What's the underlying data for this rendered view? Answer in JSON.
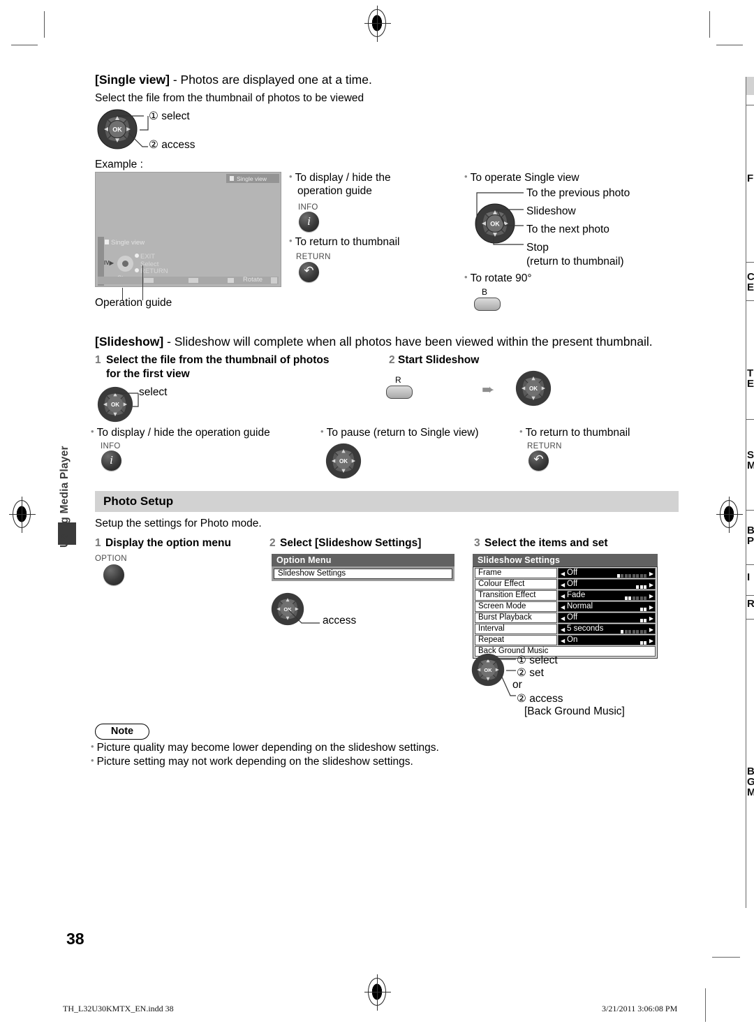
{
  "sidebar": {
    "tab_label": "Using Media Player"
  },
  "single_view": {
    "heading_bracket": "[Single view]",
    "heading_rest": " - Photos are displayed one at a time.",
    "instruction": "Select the file from the thumbnail of photos to be viewed",
    "step_select": "① select",
    "step_access": "② access",
    "example_label": "Example :",
    "operation_guide_label": "Operation guide",
    "tv": {
      "top_badge": "Single view",
      "mode_label": "Single view",
      "side_label": "IV",
      "guide_exit": "EXIT",
      "guide_select": "Select",
      "guide_return": "RETURN",
      "stop_label": "Stop",
      "rotate_label": "Rotate"
    },
    "callouts": {
      "display_hide": "To display / hide the",
      "display_hide_2": "operation guide",
      "info_cap": "INFO",
      "return_thumb": "To return to thumbnail",
      "return_cap": "RETURN",
      "operate": "To operate Single view",
      "previous_photo": "To the previous photo",
      "slideshow": "Slideshow",
      "next_photo": "To the next photo",
      "stop": "Stop",
      "stop_sub": "(return to thumbnail)",
      "rotate": "To rotate 90°",
      "rotate_btn_cap": "B"
    }
  },
  "slideshow": {
    "heading_bracket": "[Slideshow]",
    "heading_rest": " - Slideshow will complete when all photos have been viewed within the present thumbnail.",
    "step1_num": "1",
    "step1_line1": "Select the file from the thumbnail of photos",
    "step1_line2": "for the first view",
    "step1_select": "select",
    "step2_num": "2",
    "step2_label": "Start Slideshow",
    "step2_btn_cap": "R",
    "callout_display": "To display / hide the operation guide",
    "callout_display_cap": "INFO",
    "callout_pause": "To pause (return to Single view)",
    "callout_return": "To return to thumbnail",
    "callout_return_cap": "RETURN"
  },
  "photo_setup": {
    "section_title": "Photo Setup",
    "intro": "Setup the settings for Photo mode.",
    "step1_num": "1",
    "step1_label": "Display the option menu",
    "step1_btn_cap": "OPTION",
    "step2_num": "2",
    "step2_label": "Select [Slideshow Settings]",
    "step2_access": "access",
    "step3_num": "3",
    "step3_label": "Select the items and set",
    "option_menu": {
      "title": "Option Menu",
      "items": [
        "Slideshow Settings"
      ]
    },
    "slideshow_settings": {
      "title": "Slideshow Settings",
      "rows": [
        {
          "name": "Frame",
          "value": "Off",
          "gauge_on": 1,
          "gauge_total": 8
        },
        {
          "name": "Colour Effect",
          "value": "Off",
          "gauge_on": 3,
          "gauge_total": 3
        },
        {
          "name": "Transition Effect",
          "value": "Fade",
          "gauge_on": 2,
          "gauge_total": 6
        },
        {
          "name": "Screen Mode",
          "value": "Normal",
          "gauge_on": 2,
          "gauge_total": 2
        },
        {
          "name": "Burst Playback",
          "value": "Off",
          "gauge_on": 2,
          "gauge_total": 2
        },
        {
          "name": "Interval",
          "value": "5 seconds",
          "gauge_on": 1,
          "gauge_total": 7
        },
        {
          "name": "Repeat",
          "value": "On",
          "gauge_on": 2,
          "gauge_total": 2
        }
      ],
      "full_row": "Back Ground Music"
    },
    "select_label": "① select",
    "set_label": "② set",
    "or_label": "or",
    "access_label": "② access",
    "bgm_label": "[Back Ground Music]"
  },
  "note": {
    "badge": "Note",
    "items": [
      "Picture quality may become lower depending on the slideshow settings.",
      "Picture setting may not work depending on the slideshow settings."
    ]
  },
  "bleed_column": {
    "fragments": [
      "F",
      "C",
      "E",
      "T",
      "E",
      "S",
      "M",
      "B",
      "P",
      "I",
      "R",
      "B",
      "G",
      "M"
    ]
  },
  "footer": {
    "page_number": "38",
    "file_name": "TH_L32U30KMTX_EN.indd   38",
    "timestamp": "3/21/2011   3:06:08 PM"
  }
}
